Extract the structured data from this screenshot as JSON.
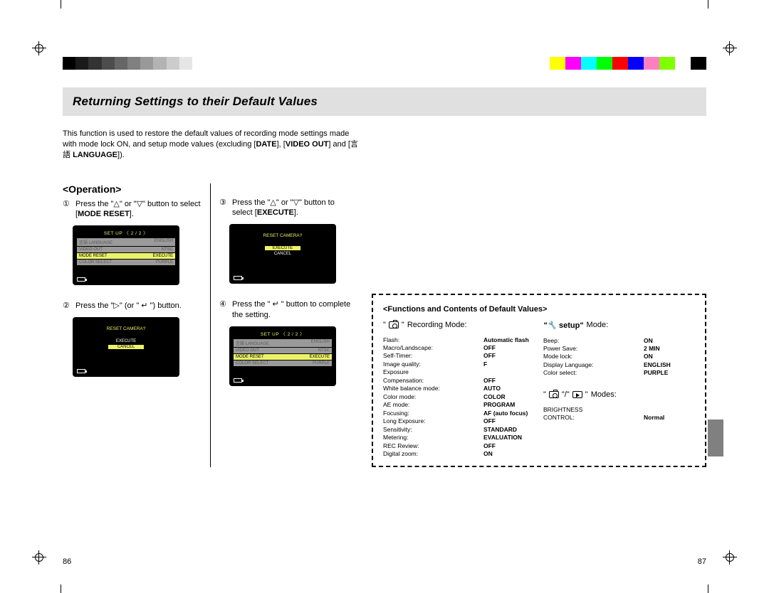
{
  "section_title": "Returning Settings to their Default Values",
  "intro_html": "This function is used to restore the default values of recording mode settings made with mode lock ON, and setup mode values (excluding [<b>DATE</b>], [<b>VIDEO OUT</b>] and [言語 <b>LANGUAGE</b>]).",
  "operation_heading": "<Operation>",
  "steps": {
    "1": {
      "num": "①",
      "html": "Press the \"△\" or \"▽\" button to select [<b>MODE RESET</b>]."
    },
    "2": {
      "num": "②",
      "html": "Press the \"▷\" (or \" ↵ \") button."
    },
    "3": {
      "num": "③",
      "html": "Press the \"△\" or \"▽\" button to select [<b>EXECUTE</b>]."
    },
    "4": {
      "num": "④",
      "html": "Press the \" ↵ \" button to complete the setting."
    }
  },
  "lcd": {
    "setup_header": "SET UP   〈 2 / 2 〉",
    "rows": [
      {
        "k": "言語 LANGUAGE",
        "v": "ENGLISH"
      },
      {
        "k": "VIDEO OUT",
        "v": "NTSC"
      },
      {
        "k": "MODE RESET",
        "v": "EXECUTE",
        "sel": true
      },
      {
        "k": "COLOR SELECT",
        "v": "PURPLE"
      }
    ],
    "reset_prompt": "RESET CAMERA?",
    "execute": "EXECUTE",
    "cancel": "CANCEL"
  },
  "defaults_box": {
    "heading": "<Functions and Contents of Default Values>",
    "rec_title": "Recording Mode:",
    "setup_title_prefix": "\" ",
    "setup_title_bold": "setup\" ",
    "setup_title_rest": "Mode:",
    "both_modes_label": "Modes:",
    "rec": [
      {
        "k": "Flash:",
        "v": "Automatic flash"
      },
      {
        "k": "Macro/Landscape:",
        "v": "OFF"
      },
      {
        "k": "Self-Timer:",
        "v": "OFF"
      },
      {
        "k": "Image quality:",
        "v": "F"
      },
      {
        "k": "Exposure",
        "v": ""
      },
      {
        "k": "Compensation:",
        "v": "OFF"
      },
      {
        "k": "White balance mode:",
        "v": "AUTO"
      },
      {
        "k": "Color mode:",
        "v": "COLOR"
      },
      {
        "k": "AE mode:",
        "v": "PROGRAM"
      },
      {
        "k": "Focusing:",
        "v": "AF (auto focus)"
      },
      {
        "k": "Long Exposure:",
        "v": "OFF"
      },
      {
        "k": "Sensitivity:",
        "v": "STANDARD"
      },
      {
        "k": "Metering:",
        "v": "EVALUATION"
      },
      {
        "k": "REC Review:",
        "v": "OFF"
      },
      {
        "k": "Digital zoom:",
        "v": "ON"
      }
    ],
    "setup": [
      {
        "k": "Beep:",
        "v": "ON"
      },
      {
        "k": "Power Save:",
        "v": "2 MIN"
      },
      {
        "k": "Mode lock:",
        "v": "ON"
      },
      {
        "k": "Display Language:",
        "v": "ENGLISH"
      },
      {
        "k": "Color select:",
        "v": "PURPLE"
      }
    ],
    "both": [
      {
        "k": "BRIGHTNESS",
        "v": ""
      },
      {
        "k": "CONTROL:",
        "v": "Normal"
      }
    ]
  },
  "page_left": "86",
  "page_right": "87",
  "color_bars_left": [
    "#000000",
    "#1a1a1a",
    "#333333",
    "#4d4d4d",
    "#666666",
    "#808080",
    "#999999",
    "#b3b3b3",
    "#cccccc",
    "#e6e6e6",
    "#ffffff"
  ],
  "color_bars_right": [
    "#ffff00",
    "#ff00ff",
    "#00ffff",
    "#00ff00",
    "#ff0000",
    "#0000ff",
    "#ff80c0",
    "#80ff00",
    "#ffffff",
    "#000000"
  ]
}
